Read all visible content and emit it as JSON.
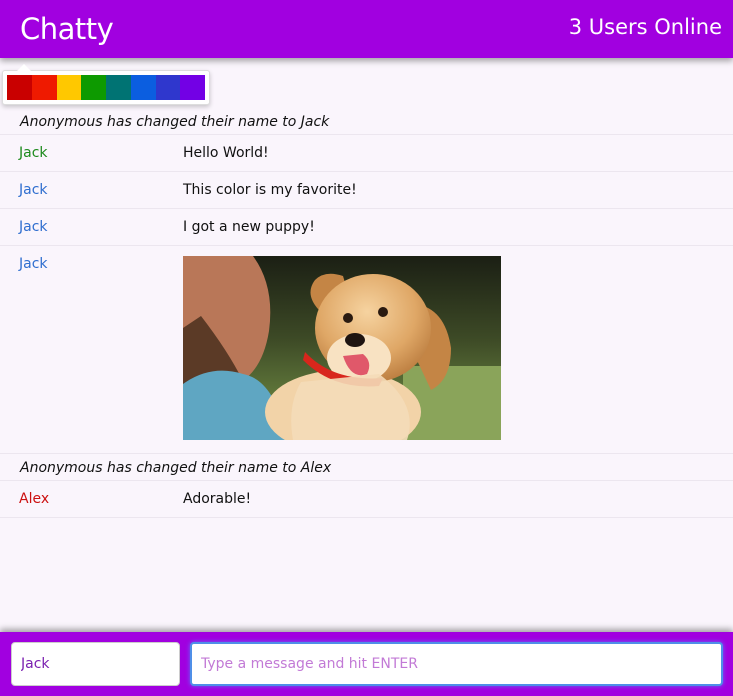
{
  "navbar": {
    "brand": "Chatty",
    "users_online": "3 Users Online"
  },
  "palette": {
    "colors": [
      "#c90000",
      "#ef1a00",
      "#ffc800",
      "#0d9a00",
      "#007373",
      "#0b5ee0",
      "#2f37cd",
      "#7300e5"
    ]
  },
  "messages": [
    {
      "type": "notice",
      "text": "Anonymous has changed their name to Jack"
    },
    {
      "type": "message",
      "user": "Jack",
      "user_color": "#1c8a1c",
      "content": "Hello World!"
    },
    {
      "type": "message",
      "user": "Jack",
      "user_color": "#2f6ecf",
      "content": "This color is my favorite!"
    },
    {
      "type": "message",
      "user": "Jack",
      "user_color": "#2f6ecf",
      "content": "I got a new puppy!"
    },
    {
      "type": "image",
      "user": "Jack",
      "user_color": "#2f6ecf"
    },
    {
      "type": "notice",
      "text": "Anonymous has changed their name to Alex"
    },
    {
      "type": "message",
      "user": "Alex",
      "user_color": "#cc1010",
      "content": "Adorable!"
    }
  ],
  "footer": {
    "name_value": "Jack",
    "message_placeholder": "Type a message and hit ENTER"
  }
}
